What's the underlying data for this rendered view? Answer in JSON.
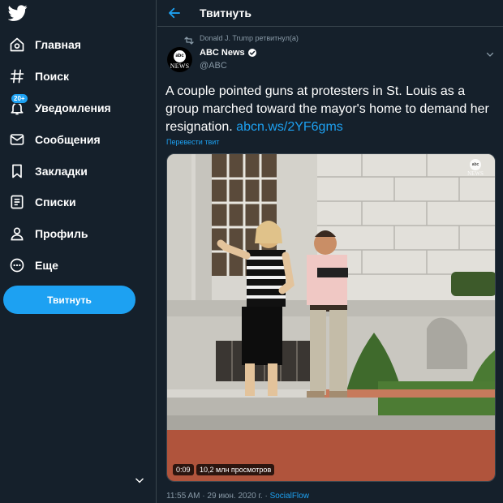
{
  "sidebar": {
    "items": [
      {
        "label": "Главная",
        "icon": "home-icon"
      },
      {
        "label": "Поиск",
        "icon": "hashtag-icon"
      },
      {
        "label": "Уведомления",
        "icon": "bell-icon",
        "badge": "20+"
      },
      {
        "label": "Сообщения",
        "icon": "envelope-icon"
      },
      {
        "label": "Закладки",
        "icon": "bookmark-icon"
      },
      {
        "label": "Списки",
        "icon": "list-icon"
      },
      {
        "label": "Профиль",
        "icon": "person-icon"
      },
      {
        "label": "Еще",
        "icon": "more-circle-icon"
      }
    ],
    "tweet_button": "Твитнуть"
  },
  "header": {
    "title": "Твитнуть"
  },
  "tweet": {
    "retweeted_by": "Donald J. Trump ретвитнул(а)",
    "author": {
      "name": "ABC News",
      "handle": "@ABC",
      "avatar_logo": "abc",
      "avatar_text": "NEWS"
    },
    "text": "A couple pointed guns at protesters in St. Louis as a group marched toward the mayor's home to demand her resignation. ",
    "link": "abcn.ws/2YF6gms",
    "translate": "Перевести твит",
    "video": {
      "duration": "0:09",
      "views": "10,2 млн просмотров",
      "watermark_logo": "abc",
      "watermark_text": "NEWS"
    },
    "time": "11:55 AM · 29 июн. 2020 г. · ",
    "source": "SocialFlow"
  },
  "colors": {
    "background": "#15202b",
    "accent": "#1da1f2",
    "muted": "#8899a6",
    "border": "#38444d"
  }
}
